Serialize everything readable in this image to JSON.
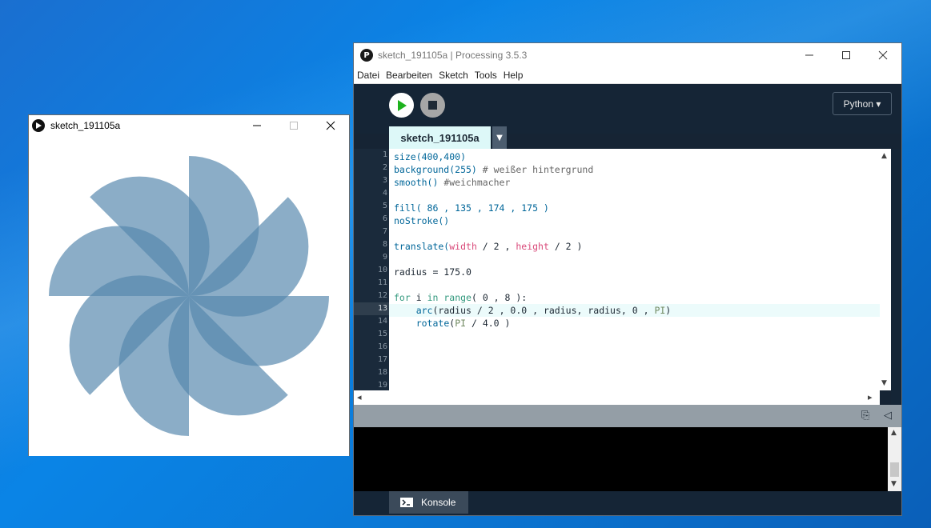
{
  "sketch_window": {
    "title": "sketch_191105a",
    "canvas": {
      "background": "#ffffff",
      "fill": "rgba(86,135,174,0.686)",
      "radius": 175,
      "petals": 8
    }
  },
  "ide": {
    "title": "sketch_191105a | Processing 3.5.3",
    "menu": [
      "Datei",
      "Bearbeiten",
      "Sketch",
      "Tools",
      "Help"
    ],
    "mode": "Python ▾",
    "tab": "sketch_191105a",
    "current_line": 13,
    "line_numbers": [
      "1",
      "2",
      "3",
      "4",
      "5",
      "6",
      "7",
      "8",
      "9",
      "10",
      "11",
      "12",
      "13",
      "14",
      "15",
      "16",
      "17",
      "18",
      "19"
    ],
    "code": {
      "l1": "size(400,400)",
      "l2a": "background(255)",
      "l2b": " # weißer hintergrund",
      "l3a": "smooth()",
      "l3b": " #weichmacher",
      "l5": "fill( 86 , 135 , 174 , 175 )",
      "l6": "noStroke()",
      "l8a": "translate(",
      "l8b": "width",
      "l8c": " / 2 , ",
      "l8d": "height",
      "l8e": " / 2 )",
      "l10": "radius = 175.0",
      "l12a": "for",
      "l12b": " i ",
      "l12c": "in",
      "l12d": " ",
      "l12e": "range",
      "l12f": "( 0 , 8 ):",
      "l13a": "    ",
      "l13b": "arc",
      "l13c": "(radius / 2 , 0.0 , radius, radius, 0 , ",
      "l13d": "PI",
      "l13e": ")",
      "l14a": "    ",
      "l14b": "rotate",
      "l14c": "(",
      "l14d": "PI",
      "l14e": " / 4.0 )"
    },
    "console_tab": "Konsole"
  }
}
